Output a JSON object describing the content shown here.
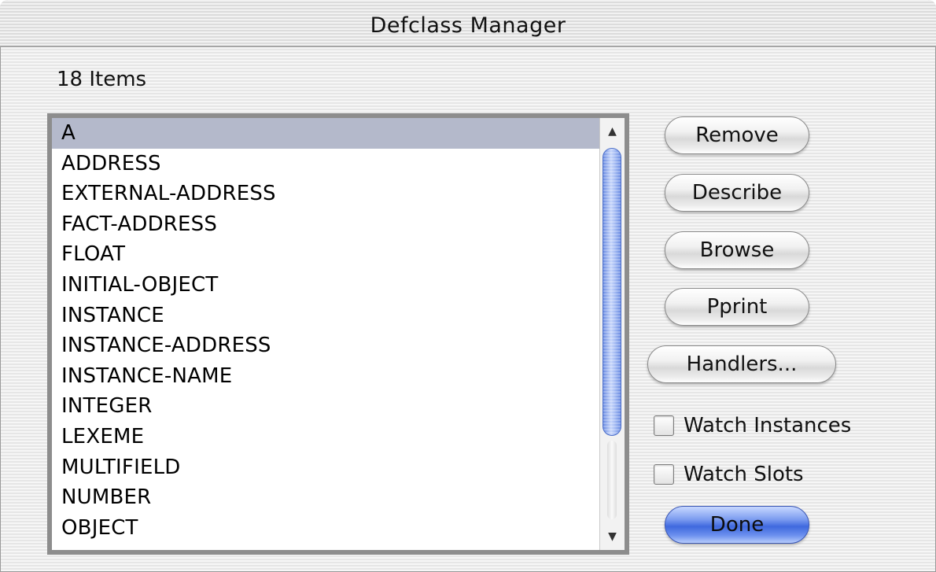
{
  "window": {
    "title": "Defclass Manager"
  },
  "count_label": "18 Items",
  "list": {
    "items": [
      "A",
      "ADDRESS",
      "EXTERNAL-ADDRESS",
      "FACT-ADDRESS",
      "FLOAT",
      "INITIAL-OBJECT",
      "INSTANCE",
      "INSTANCE-ADDRESS",
      "INSTANCE-NAME",
      "INTEGER",
      "LEXEME",
      "MULTIFIELD",
      "NUMBER",
      "OBJECT"
    ],
    "selected_index": 0
  },
  "scrollbar": {
    "up_arrow": "▲",
    "down_arrow": "▼"
  },
  "buttons": {
    "remove": "Remove",
    "describe": "Describe",
    "browse": "Browse",
    "pprint": "Pprint",
    "handlers": "Handlers...",
    "done": "Done"
  },
  "checkboxes": {
    "watch_instances": {
      "label": "Watch Instances",
      "checked": false
    },
    "watch_slots": {
      "label": "Watch Slots",
      "checked": false
    }
  },
  "colors": {
    "selection": "#b4b9cb",
    "default_button": "#4f74e0",
    "scroll_thumb": "#8fa9ee"
  }
}
